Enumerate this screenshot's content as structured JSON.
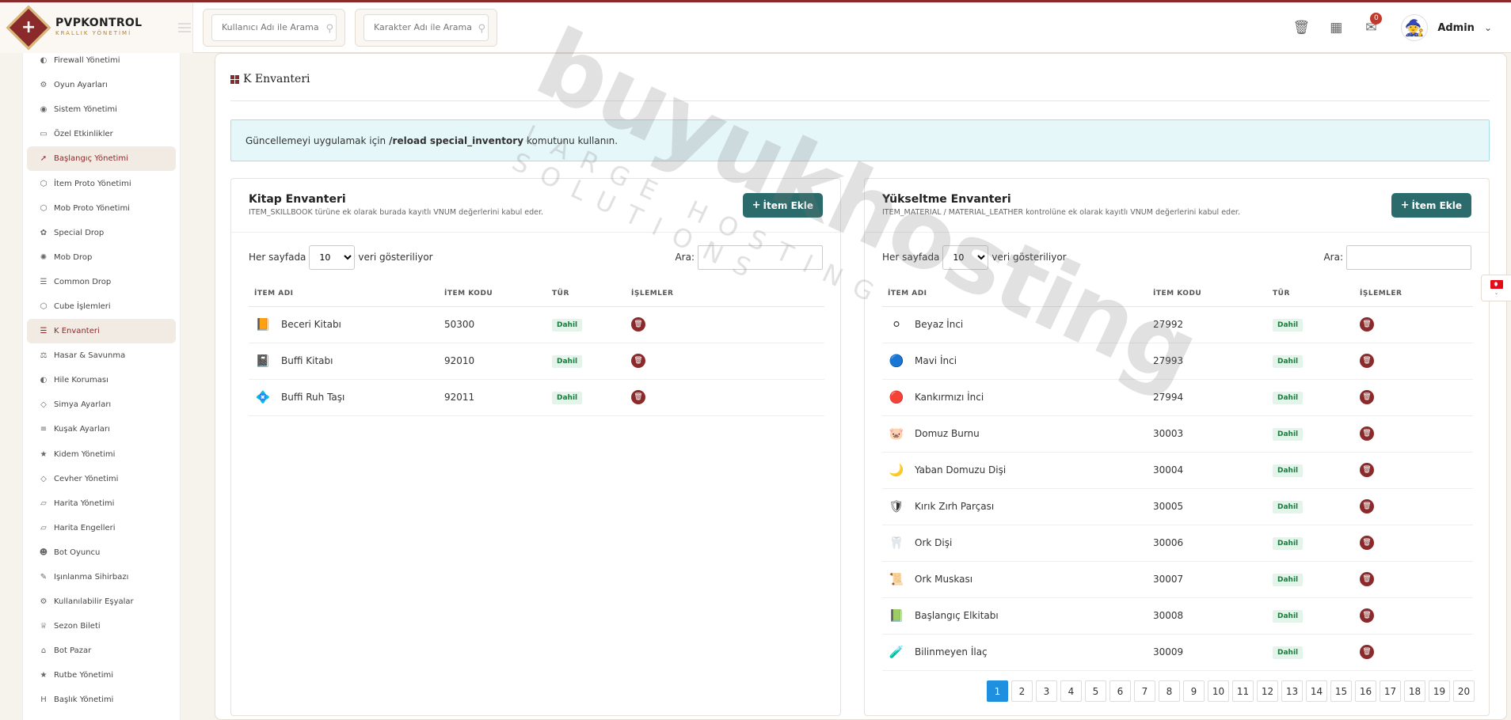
{
  "brand": {
    "title": "PVPKONTROL",
    "subtitle": "KRALLIK YÖNETİMİ"
  },
  "search": {
    "user_placeholder": "Kullanıcı Adı ile Arama",
    "char_placeholder": "Karakter Adı ile Arama"
  },
  "topbar": {
    "notifications": "0",
    "admin_name": "Admin"
  },
  "sidebar": {
    "items": [
      {
        "label": "Firewall Yönetimi",
        "icon": "◐"
      },
      {
        "label": "Oyun Ayarları",
        "icon": "⚙"
      },
      {
        "label": "Sistem Yönetimi",
        "icon": "◉"
      },
      {
        "label": "Özel Etkinlikler",
        "icon": "▭"
      },
      {
        "label": "Başlangıç Yönetimi",
        "icon": "➚"
      },
      {
        "label": "İtem Proto Yönetimi",
        "icon": "⬡"
      },
      {
        "label": "Mob Proto Yönetimi",
        "icon": "⬡"
      },
      {
        "label": "Special Drop",
        "icon": "✿"
      },
      {
        "label": "Mob Drop",
        "icon": "✺"
      },
      {
        "label": "Common Drop",
        "icon": "☰"
      },
      {
        "label": "Cube İşlemleri",
        "icon": "⬡"
      },
      {
        "label": "K Envanteri",
        "icon": "☰"
      },
      {
        "label": "Hasar & Savunma",
        "icon": "⚖"
      },
      {
        "label": "Hile Koruması",
        "icon": "◐"
      },
      {
        "label": "Simya Ayarları",
        "icon": "◇"
      },
      {
        "label": "Kuşak Ayarları",
        "icon": "≡"
      },
      {
        "label": "Kidem Yönetimi",
        "icon": "★"
      },
      {
        "label": "Cevher Yönetimi",
        "icon": "◇"
      },
      {
        "label": "Harita Yönetimi",
        "icon": "▱"
      },
      {
        "label": "Harita Engelleri",
        "icon": "▱"
      },
      {
        "label": "Bot Oyuncu",
        "icon": "☻"
      },
      {
        "label": "Işınlanma Sihirbazı",
        "icon": "✎"
      },
      {
        "label": "Kullanılabilir Eşyalar",
        "icon": "⚙"
      },
      {
        "label": "Sezon Bileti",
        "icon": "♕"
      },
      {
        "label": "Bot Pazar",
        "icon": "⌂"
      },
      {
        "label": "Rutbe Yönetimi",
        "icon": "★"
      },
      {
        "label": "Başlık Yönetimi",
        "icon": "H"
      }
    ]
  },
  "page": {
    "title": "K Envanteri",
    "alert_prefix": "Güncellemeyi uygulamak için",
    "alert_command": "/reload special_inventory",
    "alert_suffix": "komutunu kullanın."
  },
  "common": {
    "per_page_prefix": "Her sayfada",
    "per_page_value": "10",
    "per_page_suffix": "veri gösteriliyor",
    "search_label": "Ara:",
    "add_label": "İtem Ekle",
    "col_name": "İTEM ADI",
    "col_code": "İTEM KODU",
    "col_type": "TÜR",
    "col_actions": "İŞLEMLER"
  },
  "kitap": {
    "title": "Kitap Envanteri",
    "desc": "ITEM_SKILLBOOK türüne ek olarak burada kayıtlı VNUM değerlerini kabul eder.",
    "rows": [
      {
        "icon": "📙",
        "name": "Beceri Kitabı",
        "code": "50300",
        "type": "Dahil"
      },
      {
        "icon": "📓",
        "name": "Buffi Kitabı",
        "code": "92010",
        "type": "Dahil"
      },
      {
        "icon": "💠",
        "name": "Buffi Ruh Taşı",
        "code": "92011",
        "type": "Dahil"
      }
    ]
  },
  "yukseltme": {
    "title": "Yükseltme Envanteri",
    "desc": "ITEM_MATERIAL / MATERIAL_LEATHER kontrolüne ek olarak kayıtlı VNUM değerlerini kabul eder.",
    "rows": [
      {
        "icon": "⚪",
        "name": "Beyaz İnci",
        "code": "27992",
        "type": "Dahil"
      },
      {
        "icon": "🔵",
        "name": "Mavi İnci",
        "code": "27993",
        "type": "Dahil"
      },
      {
        "icon": "🔴",
        "name": "Kankırmızı İnci",
        "code": "27994",
        "type": "Dahil"
      },
      {
        "icon": "🐷",
        "name": "Domuz Burnu",
        "code": "30003",
        "type": "Dahil"
      },
      {
        "icon": "🌙",
        "name": "Yaban Domuzu Dişi",
        "code": "30004",
        "type": "Dahil"
      },
      {
        "icon": "🛡",
        "name": "Kırık Zırh Parçası",
        "code": "30005",
        "type": "Dahil"
      },
      {
        "icon": "🦷",
        "name": "Ork Dişi",
        "code": "30006",
        "type": "Dahil"
      },
      {
        "icon": "📜",
        "name": "Ork Muskası",
        "code": "30007",
        "type": "Dahil"
      },
      {
        "icon": "📗",
        "name": "Başlangıç Elkitabı",
        "code": "30008",
        "type": "Dahil"
      },
      {
        "icon": "🧪",
        "name": "Bilinmeyen İlaç",
        "code": "30009",
        "type": "Dahil"
      }
    ],
    "pages": [
      "1",
      "2",
      "3",
      "4",
      "5",
      "6",
      "7",
      "8",
      "9",
      "10",
      "11",
      "12",
      "13",
      "14",
      "15",
      "16",
      "17",
      "18",
      "19",
      "20"
    ],
    "current_page": "1"
  },
  "watermark": {
    "main": "buyukhosting",
    "sub": "LARGE HOSTING SOLUTIONS"
  },
  "colors": {
    "accent": "#8b2a2a",
    "button": "#2c6b6b",
    "pagination_active": "#1f8fe0"
  }
}
